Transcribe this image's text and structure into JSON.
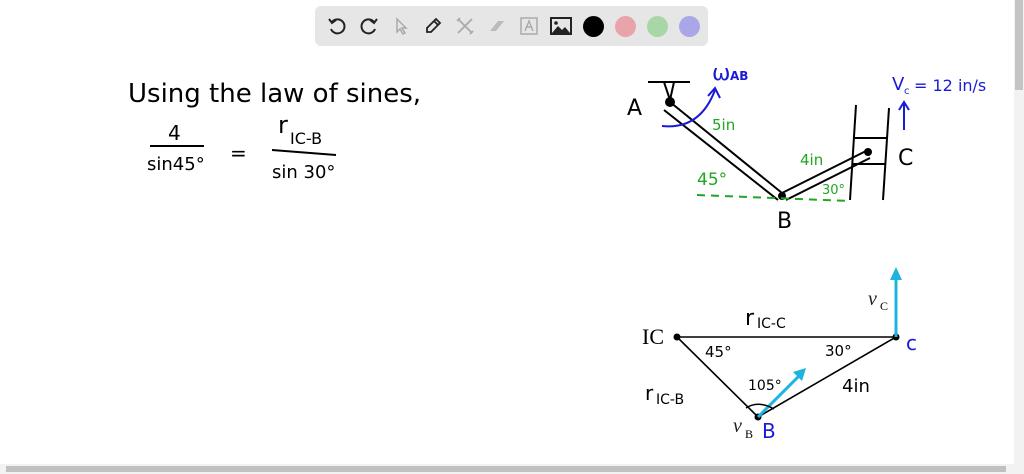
{
  "toolbar": {
    "tools": [
      "undo-icon",
      "redo-icon",
      "pointer-icon",
      "pen-icon",
      "tools-icon",
      "eraser-icon",
      "text-icon",
      "image-icon"
    ],
    "colors": [
      "#000000",
      "#e8a3ab",
      "#a8d6a6",
      "#a9a7e8"
    ]
  },
  "colors": {
    "ink": "#000000",
    "blue": "#1a1ad6",
    "green": "#22a622",
    "cyan": "#1eb4e0"
  },
  "notes": {
    "line1": "Using the law of sines,",
    "frac1_num": "4",
    "frac1_den": "sin45°",
    "equals": "=",
    "frac2_num_r": "r",
    "frac2_num_sub": "IC-B",
    "frac2_den": "sin 30°"
  },
  "mechanism": {
    "label_a": "A",
    "label_b": "B",
    "label_c": "C",
    "omega": "ω",
    "omega_sub": "AB",
    "len_ab": "5in",
    "len_bc": "4in",
    "angle_a": "45°",
    "angle_c": "30°",
    "vc_label": "V",
    "vc_sub": "c",
    "vc_value": "= 12 in/s"
  },
  "triangle": {
    "ic": "IC",
    "label_c": "c",
    "label_b": "B",
    "r_ic_c": "r",
    "r_ic_c_sub": "IC-C",
    "r_ic_b": "r",
    "r_ic_b_sub": "IC-B",
    "angle_ic": "45°",
    "angle_c": "30°",
    "angle_b": "105°",
    "len_bc": "4in",
    "vc": "v",
    "vc_sub": "C",
    "vb": "v",
    "vb_sub": "B"
  }
}
